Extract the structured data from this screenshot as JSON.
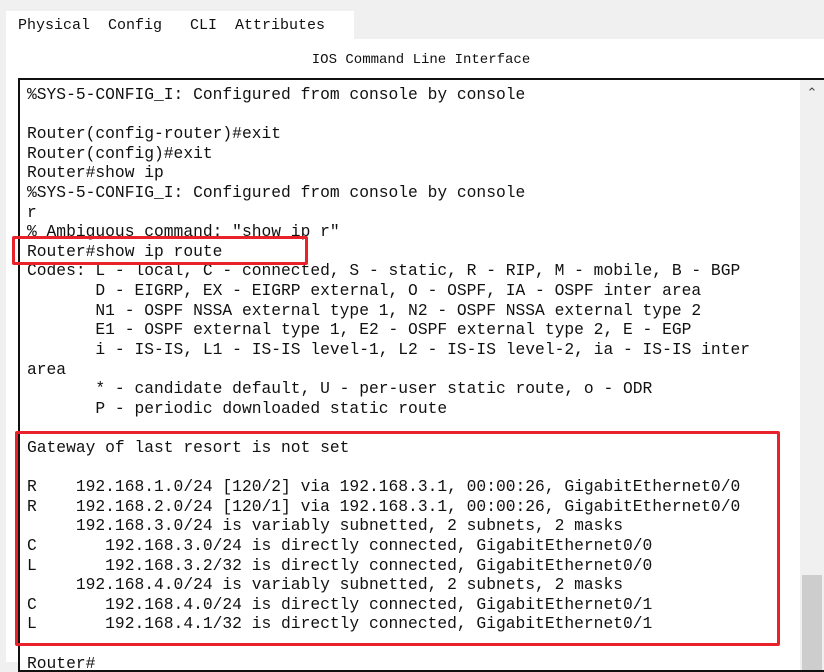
{
  "tabs": [
    {
      "label": "Physical"
    },
    {
      "label": "Config"
    },
    {
      "label": "CLI",
      "active": true
    },
    {
      "label": "Attributes"
    }
  ],
  "panel_title": "IOS Command Line Interface",
  "terminal_lines": [
    "%SYS-5-CONFIG_I: Configured from console by console",
    "",
    "Router(config-router)#exit",
    "Router(config)#exit",
    "Router#show ip",
    "%SYS-5-CONFIG_I: Configured from console by console",
    "r",
    "% Ambiguous command: \"show ip r\"",
    "Router#show ip route",
    "Codes: L - local, C - connected, S - static, R - RIP, M - mobile, B - BGP",
    "       D - EIGRP, EX - EIGRP external, O - OSPF, IA - OSPF inter area",
    "       N1 - OSPF NSSA external type 1, N2 - OSPF NSSA external type 2",
    "       E1 - OSPF external type 1, E2 - OSPF external type 2, E - EGP",
    "       i - IS-IS, L1 - IS-IS level-1, L2 - IS-IS level-2, ia - IS-IS inter",
    "area",
    "       * - candidate default, U - per-user static route, o - ODR",
    "       P - periodic downloaded static route",
    "",
    "Gateway of last resort is not set",
    "",
    "R    192.168.1.0/24 [120/2] via 192.168.3.1, 00:00:26, GigabitEthernet0/0",
    "R    192.168.2.0/24 [120/1] via 192.168.3.1, 00:00:26, GigabitEthernet0/0",
    "     192.168.3.0/24 is variably subnetted, 2 subnets, 2 masks",
    "C       192.168.3.0/24 is directly connected, GigabitEthernet0/0",
    "L       192.168.3.2/32 is directly connected, GigabitEthernet0/0",
    "     192.168.4.0/24 is variably subnetted, 2 subnets, 2 masks",
    "C       192.168.4.0/24 is directly connected, GigabitEthernet0/1",
    "L       192.168.4.1/32 is directly connected, GigabitEthernet0/1",
    "",
    "Router#"
  ],
  "highlight_color": "#e8212a",
  "scroll_icons": {
    "up": "chevron-up-icon",
    "down": "chevron-down-icon"
  }
}
